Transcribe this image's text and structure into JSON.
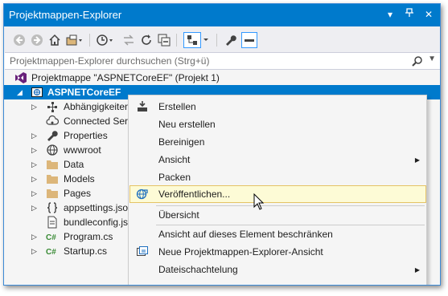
{
  "window": {
    "title": "Projektmappen-Explorer",
    "controls": {
      "pin": "▾",
      "autohide": "⊓",
      "close": "✕"
    }
  },
  "search": {
    "placeholder": "Projektmappen-Explorer durchsuchen (Strg+ü)"
  },
  "tree": {
    "solution": "Projektmappe \"ASPNETCoreEF\" (Projekt 1)",
    "project": "ASPNETCoreEF",
    "items": [
      {
        "label": "Abhängigkeiten",
        "icon": "dependencies-icon"
      },
      {
        "label": "Connected Services",
        "icon": "connected-services-icon"
      },
      {
        "label": "Properties",
        "icon": "wrench-icon"
      },
      {
        "label": "wwwroot",
        "icon": "globe-icon"
      },
      {
        "label": "Data",
        "icon": "folder-icon"
      },
      {
        "label": "Models",
        "icon": "folder-icon"
      },
      {
        "label": "Pages",
        "icon": "folder-icon"
      },
      {
        "label": "appsettings.json",
        "icon": "json-file-icon"
      },
      {
        "label": "bundleconfig.json",
        "icon": "file-icon"
      },
      {
        "label": "Program.cs",
        "icon": "csharp-file-icon"
      },
      {
        "label": "Startup.cs",
        "icon": "csharp-file-icon"
      }
    ]
  },
  "context_menu": {
    "items": [
      {
        "label": "Erstellen"
      },
      {
        "label": "Neu erstellen"
      },
      {
        "label": "Bereinigen"
      },
      {
        "label": "Ansicht"
      },
      {
        "label": "Packen"
      },
      {
        "label": "Veröffentlichen..."
      },
      {
        "label": "Übersicht"
      },
      {
        "label": "Ansicht auf dieses Element beschränken"
      },
      {
        "label": "Neue Projektmappen-Explorer-Ansicht"
      },
      {
        "label": "Dateischachtelung"
      }
    ],
    "highlighted": "Veröffentlichen..."
  },
  "colors": {
    "accent": "#007acc",
    "highlight": "#fdfbd6",
    "highlight_border": "#e5c365"
  }
}
